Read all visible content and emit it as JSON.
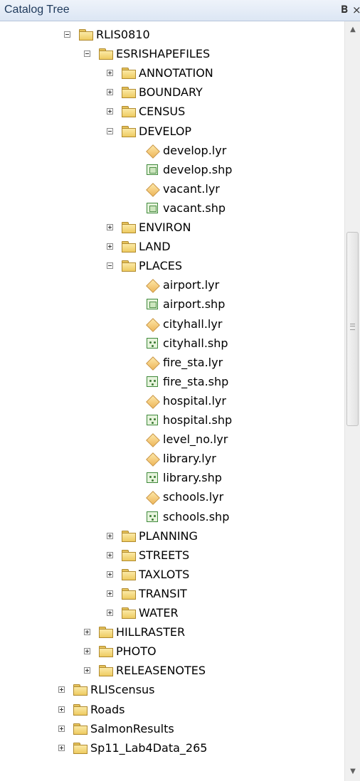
{
  "panel": {
    "title": "Catalog Tree",
    "pin_glyph": "ᵖ",
    "close_glyph": "×"
  },
  "tree": [
    {
      "label": "RLIS0810",
      "type": "folder",
      "expanded": true,
      "depth": 3
    },
    {
      "label": "ESRISHAPEFILES",
      "type": "folder",
      "expanded": true,
      "depth": 4
    },
    {
      "label": "ANNOTATION",
      "type": "folder",
      "expanded": false,
      "depth": 5
    },
    {
      "label": "BOUNDARY",
      "type": "folder",
      "expanded": false,
      "depth": 5
    },
    {
      "label": "CENSUS",
      "type": "folder",
      "expanded": false,
      "depth": 5
    },
    {
      "label": "DEVELOP",
      "type": "folder",
      "expanded": true,
      "depth": 5
    },
    {
      "label": "develop.lyr",
      "type": "layer",
      "depth": 6
    },
    {
      "label": "develop.shp",
      "type": "shapefile-polygon",
      "depth": 6
    },
    {
      "label": "vacant.lyr",
      "type": "layer",
      "depth": 6
    },
    {
      "label": "vacant.shp",
      "type": "shapefile-polygon",
      "depth": 6
    },
    {
      "label": "ENVIRON",
      "type": "folder",
      "expanded": false,
      "depth": 5
    },
    {
      "label": "LAND",
      "type": "folder",
      "expanded": false,
      "depth": 5
    },
    {
      "label": "PLACES",
      "type": "folder",
      "expanded": true,
      "depth": 5
    },
    {
      "label": "airport.lyr",
      "type": "layer",
      "depth": 6
    },
    {
      "label": "airport.shp",
      "type": "shapefile-polygon",
      "depth": 6
    },
    {
      "label": "cityhall.lyr",
      "type": "layer",
      "depth": 6
    },
    {
      "label": "cityhall.shp",
      "type": "shapefile-point",
      "depth": 6
    },
    {
      "label": "fire_sta.lyr",
      "type": "layer",
      "depth": 6
    },
    {
      "label": "fire_sta.shp",
      "type": "shapefile-point",
      "depth": 6
    },
    {
      "label": "hospital.lyr",
      "type": "layer",
      "depth": 6
    },
    {
      "label": "hospital.shp",
      "type": "shapefile-point",
      "depth": 6
    },
    {
      "label": "level_no.lyr",
      "type": "layer",
      "depth": 6
    },
    {
      "label": "library.lyr",
      "type": "layer",
      "depth": 6
    },
    {
      "label": "library.shp",
      "type": "shapefile-point",
      "depth": 6
    },
    {
      "label": "schools.lyr",
      "type": "layer",
      "depth": 6
    },
    {
      "label": "schools.shp",
      "type": "shapefile-point",
      "depth": 6
    },
    {
      "label": "PLANNING",
      "type": "folder",
      "expanded": false,
      "depth": 5
    },
    {
      "label": "STREETS",
      "type": "folder",
      "expanded": false,
      "depth": 5
    },
    {
      "label": "TAXLOTS",
      "type": "folder",
      "expanded": false,
      "depth": 5
    },
    {
      "label": "TRANSIT",
      "type": "folder",
      "expanded": false,
      "depth": 5
    },
    {
      "label": "WATER",
      "type": "folder",
      "expanded": false,
      "depth": 5
    },
    {
      "label": "HILLRASTER",
      "type": "folder",
      "expanded": false,
      "depth": 4
    },
    {
      "label": "PHOTO",
      "type": "folder",
      "expanded": false,
      "depth": 4
    },
    {
      "label": "RELEASENOTES",
      "type": "folder",
      "expanded": false,
      "depth": 4
    },
    {
      "label": "RLIScensus",
      "type": "folder",
      "expanded": false,
      "depth": 2
    },
    {
      "label": "Roads",
      "type": "folder",
      "expanded": false,
      "depth": 2
    },
    {
      "label": "SalmonResults",
      "type": "folder",
      "expanded": false,
      "depth": 2
    },
    {
      "label": "Sp11_Lab4Data_265",
      "type": "folder",
      "expanded": false,
      "depth": 2
    }
  ],
  "scrollbar": {
    "up_glyph": "▲",
    "down_glyph": "▼",
    "thumb_grip": "≡"
  }
}
